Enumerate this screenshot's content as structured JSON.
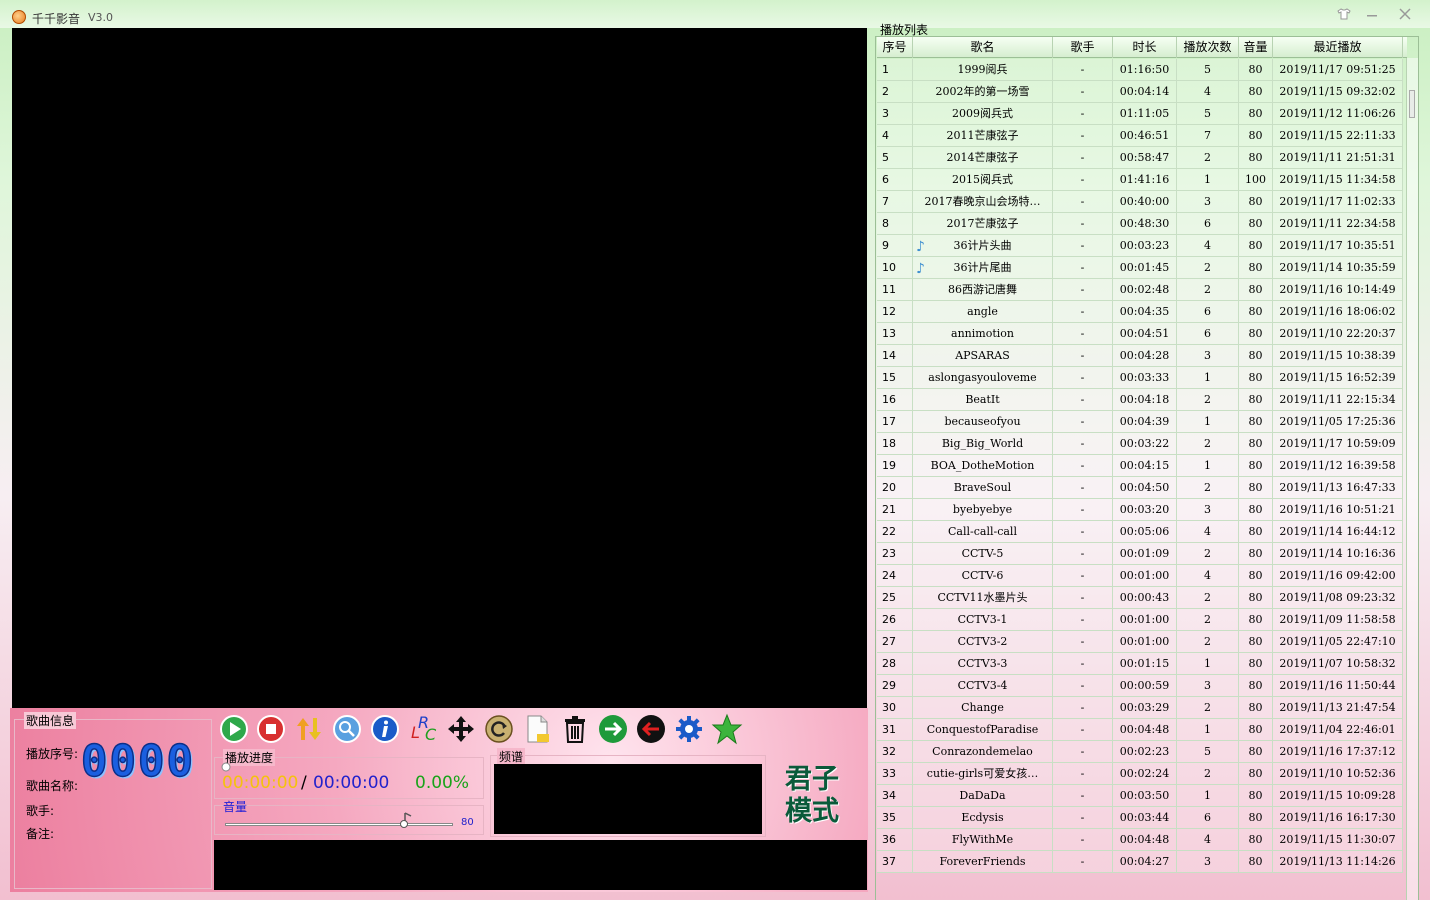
{
  "window": {
    "title": "千千影音",
    "version": "V3.0",
    "buttons": [
      "shirt-icon",
      "minimize-icon",
      "close-icon"
    ]
  },
  "info": {
    "legend": "歌曲信息",
    "seq_label": "播放序号:",
    "seq_value": "0000",
    "name_label": "歌曲名称:",
    "singer_label": "歌手:",
    "note_label": "备注:"
  },
  "toolbar": [
    "play-icon",
    "stop-icon",
    "sort-icon",
    "search-icon",
    "info-icon",
    "lyric-icon",
    "move-icon",
    "refresh-icon",
    "new-file-icon",
    "delete-icon",
    "next-icon",
    "prev-icon",
    "settings-icon",
    "favorite-star-icon"
  ],
  "toolbar_lrc": {
    "l": "L",
    "r": "R",
    "c": "C"
  },
  "progress": {
    "legend": "播放进度",
    "current": "00:00:00",
    "sep": "/",
    "total": "00:00:00",
    "percent": "0.00%"
  },
  "volume": {
    "legend": "音量",
    "value": "80",
    "level": 0.8
  },
  "spectrum": {
    "legend": "频谱"
  },
  "mode": {
    "label": "君子模式"
  },
  "playlist": {
    "title": "播放列表",
    "columns": [
      "序号",
      "歌名",
      "歌手",
      "时长",
      "播放次数",
      "音量",
      "最近播放"
    ],
    "rows": [
      [
        "1",
        "1999阅兵",
        "-",
        "01:16:50",
        "5",
        "80",
        "2019/11/17 09:51:25",
        false
      ],
      [
        "2",
        "2002年的第一场雪",
        "-",
        "00:04:14",
        "4",
        "80",
        "2019/11/15 09:32:02",
        false
      ],
      [
        "3",
        "2009阅兵式",
        "-",
        "01:11:05",
        "5",
        "80",
        "2019/11/12 11:06:26",
        false
      ],
      [
        "4",
        "2011芒康弦子",
        "-",
        "00:46:51",
        "7",
        "80",
        "2019/11/15 22:11:33",
        false
      ],
      [
        "5",
        "2014芒康弦子",
        "-",
        "00:58:47",
        "2",
        "80",
        "2019/11/11 21:51:31",
        false
      ],
      [
        "6",
        "2015阅兵式",
        "-",
        "01:41:16",
        "1",
        "100",
        "2019/11/15 11:34:58",
        false
      ],
      [
        "7",
        "2017春晚京山会场特…",
        "-",
        "00:40:00",
        "3",
        "80",
        "2019/11/17 11:02:33",
        false
      ],
      [
        "8",
        "2017芒康弦子",
        "-",
        "00:48:30",
        "6",
        "80",
        "2019/11/11 22:34:58",
        false
      ],
      [
        "9",
        "36计片头曲",
        "-",
        "00:03:23",
        "4",
        "80",
        "2019/11/17 10:35:51",
        true
      ],
      [
        "10",
        "36计片尾曲",
        "-",
        "00:01:45",
        "2",
        "80",
        "2019/11/14 10:35:59",
        true
      ],
      [
        "11",
        "86西游记唐舞",
        "-",
        "00:02:48",
        "2",
        "80",
        "2019/11/16 10:14:49",
        false
      ],
      [
        "12",
        "angle",
        "-",
        "00:04:35",
        "6",
        "80",
        "2019/11/16 18:06:02",
        false
      ],
      [
        "13",
        "annimotion",
        "-",
        "00:04:51",
        "6",
        "80",
        "2019/11/10 22:20:37",
        false
      ],
      [
        "14",
        "APSARAS",
        "-",
        "00:04:28",
        "3",
        "80",
        "2019/11/15 10:38:39",
        false
      ],
      [
        "15",
        "aslongasyouloveme",
        "-",
        "00:03:33",
        "1",
        "80",
        "2019/11/15 16:52:39",
        false
      ],
      [
        "16",
        "BeatIt",
        "-",
        "00:04:18",
        "2",
        "80",
        "2019/11/11 22:15:34",
        false
      ],
      [
        "17",
        "becauseofyou",
        "-",
        "00:04:39",
        "1",
        "80",
        "2019/11/05 17:25:36",
        false
      ],
      [
        "18",
        "Big_Big_World",
        "-",
        "00:03:22",
        "2",
        "80",
        "2019/11/17 10:59:09",
        false
      ],
      [
        "19",
        "BOA_DotheMotion",
        "-",
        "00:04:15",
        "1",
        "80",
        "2019/11/12 16:39:58",
        false
      ],
      [
        "20",
        "BraveSoul",
        "-",
        "00:04:50",
        "2",
        "80",
        "2019/11/13 16:47:33",
        false
      ],
      [
        "21",
        "byebyebye",
        "-",
        "00:03:20",
        "3",
        "80",
        "2019/11/16 10:51:21",
        false
      ],
      [
        "22",
        "Call-call-call",
        "-",
        "00:05:06",
        "4",
        "80",
        "2019/11/14 16:44:12",
        false
      ],
      [
        "23",
        "CCTV-5",
        "-",
        "00:01:09",
        "2",
        "80",
        "2019/11/14 10:16:36",
        false
      ],
      [
        "24",
        "CCTV-6",
        "-",
        "00:01:00",
        "4",
        "80",
        "2019/11/16 09:42:00",
        false
      ],
      [
        "25",
        "CCTV11水墨片头",
        "-",
        "00:00:43",
        "2",
        "80",
        "2019/11/08 09:23:32",
        false
      ],
      [
        "26",
        "CCTV3-1",
        "-",
        "00:01:00",
        "2",
        "80",
        "2019/11/09 11:58:58",
        false
      ],
      [
        "27",
        "CCTV3-2",
        "-",
        "00:01:00",
        "2",
        "80",
        "2019/11/05 22:47:10",
        false
      ],
      [
        "28",
        "CCTV3-3",
        "-",
        "00:01:15",
        "1",
        "80",
        "2019/11/07 10:58:32",
        false
      ],
      [
        "29",
        "CCTV3-4",
        "-",
        "00:00:59",
        "3",
        "80",
        "2019/11/16 11:50:44",
        false
      ],
      [
        "30",
        "Change",
        "-",
        "00:03:29",
        "2",
        "80",
        "2019/11/13 21:47:54",
        false
      ],
      [
        "31",
        "ConquestofParadise",
        "-",
        "00:04:48",
        "1",
        "80",
        "2019/11/04 22:46:01",
        false
      ],
      [
        "32",
        "Conrazondemelao",
        "-",
        "00:02:23",
        "5",
        "80",
        "2019/11/16 17:37:12",
        false
      ],
      [
        "33",
        "cutie-girls可爱女孩…",
        "-",
        "00:02:24",
        "2",
        "80",
        "2019/11/10 10:52:36",
        false
      ],
      [
        "34",
        "DaDaDa",
        "-",
        "00:03:50",
        "1",
        "80",
        "2019/11/15 10:09:28",
        false
      ],
      [
        "35",
        "Ecdysis",
        "-",
        "00:03:44",
        "6",
        "80",
        "2019/11/16 16:17:30",
        false
      ],
      [
        "36",
        "FlyWithMe",
        "-",
        "00:04:48",
        "4",
        "80",
        "2019/11/15 11:30:07",
        false
      ],
      [
        "37",
        "ForeverFriends",
        "-",
        "00:04:27",
        "3",
        "80",
        "2019/11/13 11:14:26",
        false
      ]
    ]
  },
  "colors": {
    "accent_blue": "#1a5fe0",
    "time_yellow": "#f4c20d",
    "time_blue": "#2222cc",
    "percent_green": "#1aa31a",
    "mode_green": "#0a5a3a"
  }
}
